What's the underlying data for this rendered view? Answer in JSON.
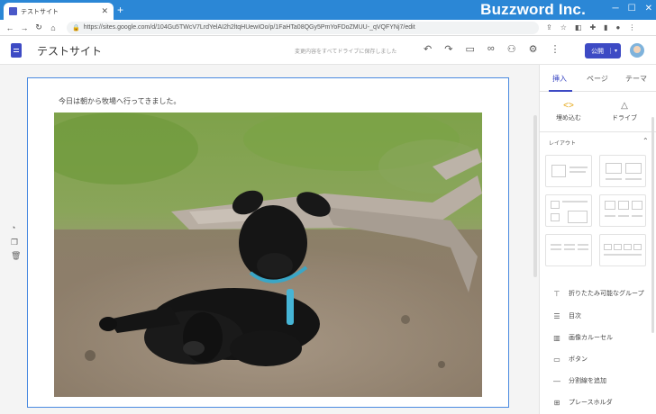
{
  "browser": {
    "tab_title": "テストサイト",
    "url": "https://sites.google.com/d/104Gu5TWcV7LrdYelAI2h2ltqHUewIOo/p/1FaHTa08QGy5PmYoFDoZMUU-_qVQFYNj7/edit",
    "brand": "Buzzword Inc.",
    "nav_icons": [
      "back-icon",
      "forward-icon",
      "reload-icon",
      "home-icon"
    ]
  },
  "header": {
    "site_name": "テストサイト",
    "save_status": "変更内容をすべてドライブに保存しました",
    "publish_label": "公開"
  },
  "content": {
    "caption": "今日は朝から牧場へ行ってきました。",
    "photo_subject": "black-lamb-photo"
  },
  "panel": {
    "tabs": [
      {
        "label": "挿入",
        "active": true
      },
      {
        "label": "ページ",
        "active": false
      },
      {
        "label": "テーマ",
        "active": false
      }
    ],
    "insert": [
      {
        "label": "埋め込む",
        "icon": "embed-icon"
      },
      {
        "label": "ドライブ",
        "icon": "drive-icon"
      }
    ],
    "layout_title": "レイアウト",
    "items": [
      {
        "label": "折りたたみ可能なグループ",
        "icon": "collapsible-group-icon"
      },
      {
        "label": "目次",
        "icon": "toc-icon"
      },
      {
        "label": "画像カルーセル",
        "icon": "carousel-icon"
      },
      {
        "label": "ボタン",
        "icon": "button-icon"
      },
      {
        "label": "分割線を追加",
        "icon": "divider-icon"
      },
      {
        "label": "プレースホルダ",
        "icon": "placeholder-icon"
      }
    ]
  },
  "colors": {
    "accent": "#3d4ac4",
    "titlebar": "#2b87d6",
    "selection": "#4a8ae0"
  }
}
